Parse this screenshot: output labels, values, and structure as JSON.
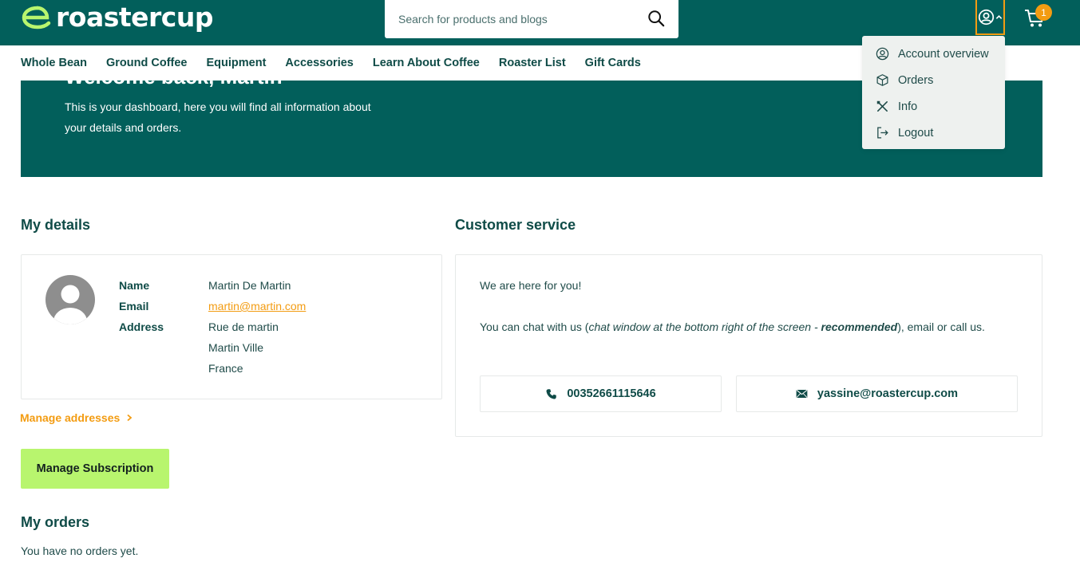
{
  "brand": {
    "name": "roastercup",
    "primary": "#025f5b",
    "accent": "#f39c12",
    "cta": "#b8f56e"
  },
  "search": {
    "placeholder": "Search for products and blogs",
    "icon": "search-icon"
  },
  "cart": {
    "count": "1"
  },
  "nav": {
    "items": [
      {
        "label": "Whole Bean"
      },
      {
        "label": "Ground Coffee"
      },
      {
        "label": "Equipment"
      },
      {
        "label": "Accessories"
      },
      {
        "label": "Learn About Coffee"
      },
      {
        "label": "Roaster List"
      },
      {
        "label": "Gift Cards"
      }
    ]
  },
  "hero": {
    "title": "Welcome back, Martin",
    "text": "This is your dashboard, here you will find all information about your details and orders."
  },
  "account_menu": {
    "items": [
      {
        "label": "Account overview",
        "icon": "user-circle-icon"
      },
      {
        "label": "Orders",
        "icon": "box-icon"
      },
      {
        "label": "Info",
        "icon": "tools-icon"
      },
      {
        "label": "Logout",
        "icon": "logout-icon"
      }
    ]
  },
  "details": {
    "title": "My details",
    "name_label": "Name",
    "name": "Martin De Martin",
    "email_label": "Email",
    "email": "martin@martin.com",
    "address_label": "Address",
    "address_lines": [
      "Rue de martin",
      "Martin Ville",
      "France"
    ],
    "manage_addresses": "Manage addresses",
    "manage_subscription": "Manage Subscription"
  },
  "customer_service": {
    "title": "Customer service",
    "intro": "We are here for you!",
    "text_start": "You can chat with us (",
    "text_italic": "chat window at the bottom right of the screen - ",
    "text_bold_italic": "recommended",
    "text_end": "), email or call us.",
    "phone": "00352661115646",
    "email": "yassine@roastercup.com"
  },
  "orders": {
    "title": "My orders",
    "empty": "You have no orders yet."
  }
}
